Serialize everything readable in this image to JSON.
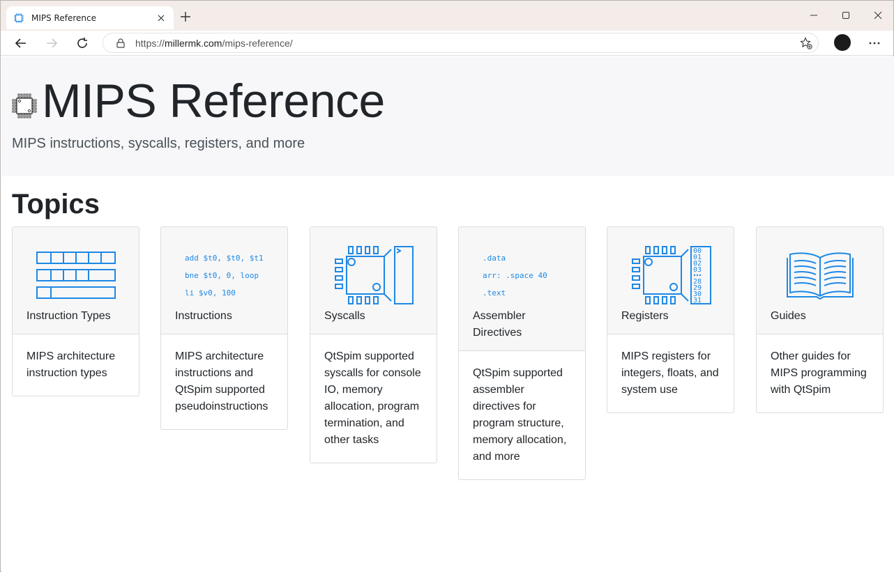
{
  "browser": {
    "tab_title": "MIPS Reference",
    "url_prefix": "https://",
    "url_host": "millermk.com",
    "url_path": "/mips-reference/"
  },
  "header": {
    "title": "MIPS Reference",
    "tagline": "MIPS instructions, syscalls, registers, and more"
  },
  "topics_heading": "Topics",
  "cards": [
    {
      "title": "Instruction Types",
      "description": "MIPS architecture instruction types"
    },
    {
      "title": "Instructions",
      "description": "MIPS architecture instructions and QtSpim supported pseudoinstructions",
      "code": [
        "add $t0, $t0, $t1",
        "bne $t0, 0, loop",
        "li $v0, 100"
      ]
    },
    {
      "title": "Syscalls",
      "description": "QtSpim supported syscalls for console IO, memory allocation, program termination, and other tasks"
    },
    {
      "title": "Assembler Directives",
      "description": "QtSpim supported assembler directives for program structure, memory allocation, and more",
      "code": [
        ".data",
        "arr: .space 40",
        ".text"
      ]
    },
    {
      "title": "Registers",
      "description": "MIPS registers for integers, floats, and system use",
      "register_labels": [
        "00",
        "01",
        "02",
        "03",
        "28",
        "29",
        "30",
        "31"
      ]
    },
    {
      "title": "Guides",
      "description": "Other guides for MIPS programming with QtSpim"
    }
  ],
  "colors": {
    "accent": "#1e88e5",
    "jumbotron": "#f7f7f9",
    "tab_strip": "#f3ece8"
  }
}
